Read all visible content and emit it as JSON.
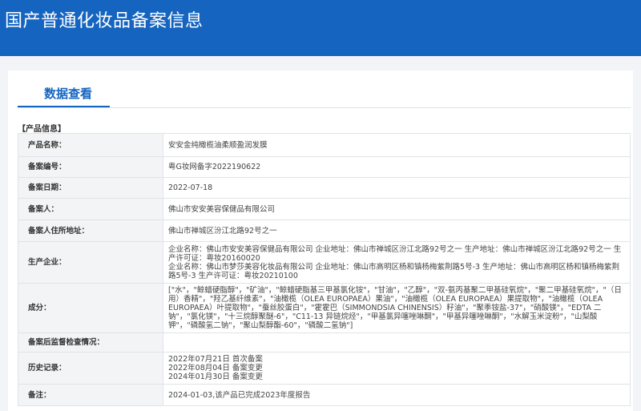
{
  "header": {
    "title": "国产普通化妆品备案信息"
  },
  "tab": {
    "label": "数据查看"
  },
  "section": {
    "title": "【产品信息】"
  },
  "rows": [
    {
      "label": "产品名称：",
      "value": "安安金纯橄榄油柔顺盈润发膜"
    },
    {
      "label": "备案编号：",
      "value": "粤G妆网备字2022190622"
    },
    {
      "label": "备案日期：",
      "value": "2022-07-18"
    },
    {
      "label": "备案人：",
      "value": "佛山市安安美容保健品有限公司"
    },
    {
      "label": "备案人住所地址：",
      "value": "佛山市禅城区汾江北路92号之一"
    },
    {
      "label": "生产企业：",
      "lines": [
        "企业名称：佛山市安安美容保健品有限公司 企业地址：佛山市禅城区汾江北路92号之一 生产地址：佛山市禅城区汾江北路92号之一 生产许可证：粤妆20160020",
        "企业名称：佛山市梦莎美容化妆品有限公司 企业地址：佛山市高明区杨和镇杨梅紫荆路5号-3 生产地址：佛山市高明区杨和镇杨梅紫荆路5号-3 生产许可证：粤妆20210100"
      ]
    },
    {
      "label": "成分：",
      "value": "[\"水\"，\"鲸蜡硬脂醇\"，\"矿油\"，\"鲸蜡硬脂基三甲基氯化铵\"，\"甘油\"，\"乙醇\"，\"双-氨丙基聚二甲基硅氧烷\"，\"聚二甲基硅氧烷\"，\"（日用）香精\"，\"羟乙基纤维素\"，\"油橄榄（OLEA EUROPAEA）果油\"，\"油橄榄（OLEA EUROPAEA）果提取物\"，\"油橄榄（OLEA EUROPAEA）叶提取物\"，\"蚕丝胶蛋白\"，\"霍霍巴（SIMMONDSIA CHINENSIS）籽油\"，\"聚季铵盐-37\"，\"硝酸镁\"，\"EDTA 二钠\"，\"氯化镁\"，\"十三烷醇聚醚-6\"，\"C11-13 异链烷烃\"，\"甲基氯异噻唑啉酮\"，\"甲基异噻唑啉酮\"，\"水解玉米淀粉\"，\"山梨酸钾\"，\"磷酸氢二钠\"，\"聚山梨醇酯-60\"，\"磷酸二氢钠\"]"
    },
    {
      "label": "备案后监督检查情况：",
      "value": ""
    },
    {
      "label": "历史记录：",
      "lines": [
        "2022年07月21日 首次备案",
        "2022年08月04日 备案变更",
        "2024年01月30日 备案变更"
      ]
    },
    {
      "label": "备注：",
      "value": "2024-01-03,该产品已完成2023年度报告"
    }
  ]
}
